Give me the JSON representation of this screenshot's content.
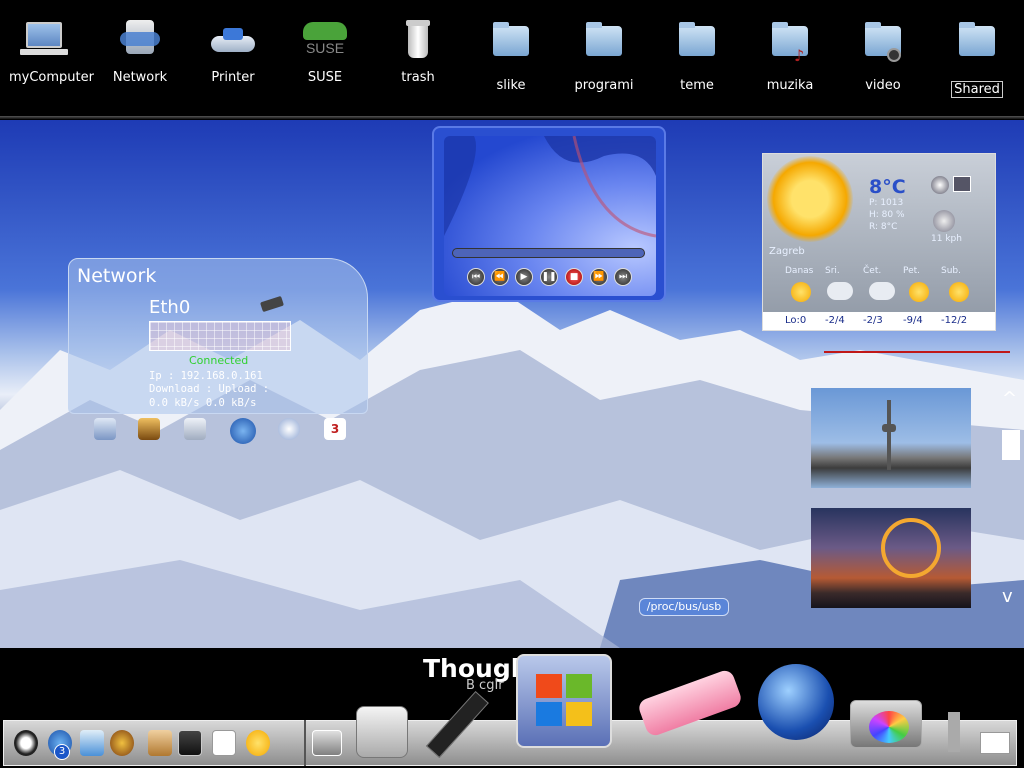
{
  "desktop_icons": [
    {
      "label": "myComputer",
      "icon": "laptop-icon"
    },
    {
      "label": "Network",
      "icon": "network-icon"
    },
    {
      "label": "Printer",
      "icon": "printer-icon"
    },
    {
      "label": "SUSE",
      "icon": "suse-icon",
      "glyph_text": "SUSE"
    },
    {
      "label": "trash",
      "icon": "trash-icon"
    },
    {
      "label": "slike",
      "icon": "folder-pictures-icon"
    },
    {
      "label": "programi",
      "icon": "folder-programs-icon"
    },
    {
      "label": "teme",
      "icon": "folder-icon"
    },
    {
      "label": "muzika",
      "icon": "folder-music-icon"
    },
    {
      "label": "video",
      "icon": "folder-video-icon"
    },
    {
      "label": "Shared",
      "icon": "folder-shared-icon"
    }
  ],
  "network_widget": {
    "title": "Network",
    "interface": "Eth0",
    "status": "Connected",
    "ip_line": "Ip : 192.168.0.161",
    "labels_line": "Download :   Upload :",
    "values_line": "0.0 kB/s     0.0 kB/s",
    "status_color": "#2fd02f"
  },
  "media_player": {
    "buttons": [
      "first",
      "rewind",
      "play",
      "pause",
      "stop",
      "forward",
      "last"
    ]
  },
  "weather": {
    "temperature": "8°C",
    "pressure": "P: 1013",
    "humidity": "H: 80 %",
    "realfeel": "R: 8°C",
    "wind": "11 kph",
    "location": "Zagreb",
    "days": [
      "Danas",
      "Sri.",
      "Čet.",
      "Pet.",
      "Sub."
    ],
    "temps": [
      "Lo:0",
      "-2/4",
      "-2/3",
      "-9/4",
      "-12/2"
    ]
  },
  "tooltip": "/proc/bus/usb",
  "thought": {
    "title": "Though",
    "subtitle": "B   cgIr"
  },
  "taskbar_icons": [
    "tux-icon",
    "browser-icon",
    "mail-icon",
    "film-icon",
    "address-book-icon",
    "user-icon",
    "terminal-icon",
    "loader-icon",
    "sun-icon",
    "media-icon"
  ],
  "dock_icons": [
    "hard-drive-icon",
    "memory-stick-icon",
    "windows-drive-icon",
    "usb-stick-icon",
    "globe-icon",
    "camera-icon",
    "tools-icon"
  ],
  "badge": "3"
}
